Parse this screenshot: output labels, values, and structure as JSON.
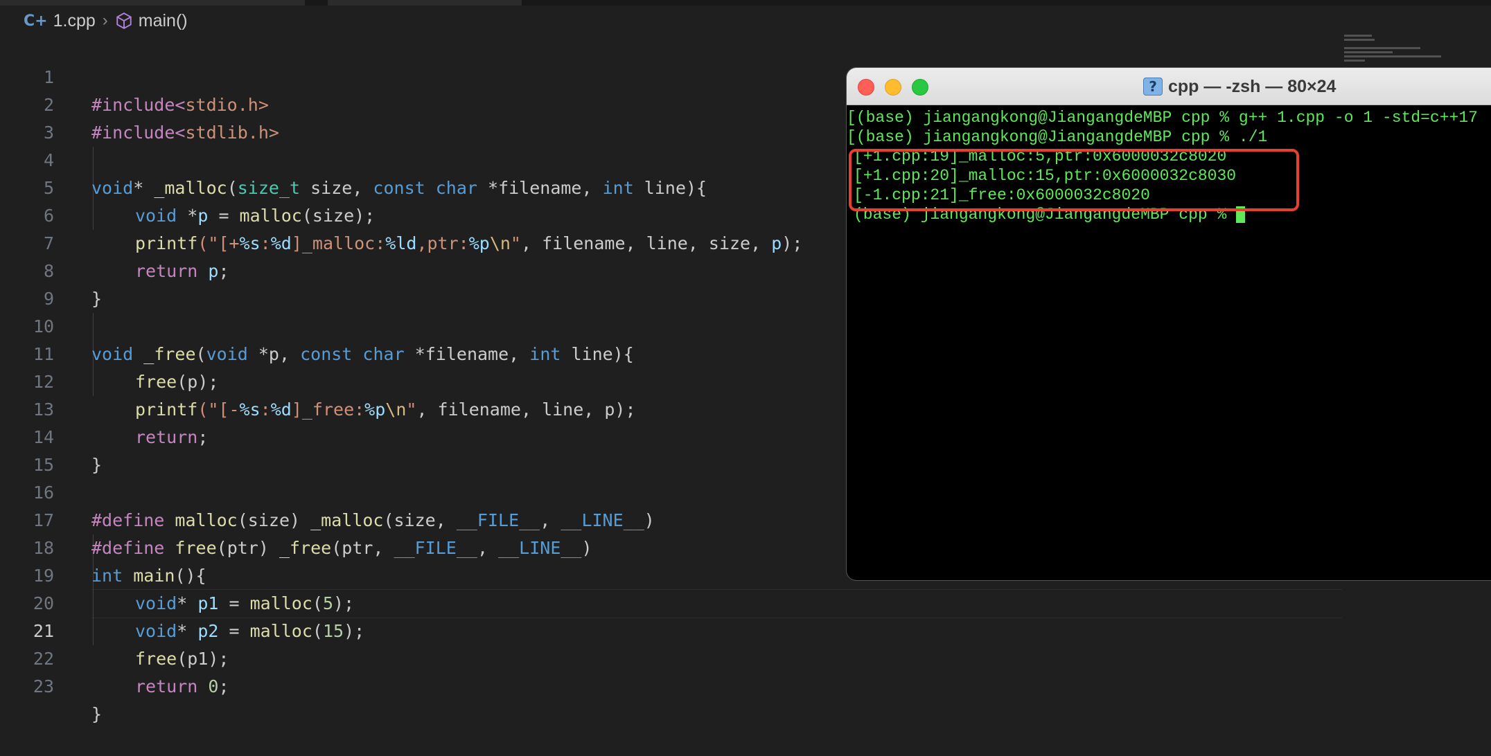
{
  "breadcrumb": {
    "file": "1.cpp",
    "symbol": "main()"
  },
  "editor": {
    "active_line": 21,
    "lines": [
      {
        "n": "1"
      },
      {
        "n": "2"
      },
      {
        "n": "3"
      },
      {
        "n": "4"
      },
      {
        "n": "5"
      },
      {
        "n": "6"
      },
      {
        "n": "7"
      },
      {
        "n": "8"
      },
      {
        "n": "9"
      },
      {
        "n": "10"
      },
      {
        "n": "11"
      },
      {
        "n": "12"
      },
      {
        "n": "13"
      },
      {
        "n": "14"
      },
      {
        "n": "15"
      },
      {
        "n": "16"
      },
      {
        "n": "17"
      },
      {
        "n": "18"
      },
      {
        "n": "19"
      },
      {
        "n": "20"
      },
      {
        "n": "21"
      },
      {
        "n": "22"
      },
      {
        "n": "23"
      }
    ],
    "tokens": {
      "l1_a": "#include<",
      "l1_b": "stdio.h",
      "l1_c": ">",
      "l2_a": "#include<",
      "l2_b": "stdlib.h",
      "l2_c": ">",
      "l4_a": "void",
      "l4_b": "* ",
      "l4_c": "_malloc",
      "l4_d": "(",
      "l4_e": "size_t",
      "l4_f": " size, ",
      "l4_g": "const",
      "l4_h": " ",
      "l4_i": "char",
      "l4_j": " *filename, ",
      "l4_k": "int",
      "l4_l": " line){",
      "l5_a": "void",
      "l5_b": " *",
      "l5_c": "p",
      "l5_d": " = ",
      "l5_e": "malloc",
      "l5_f": "(size);",
      "l6_a": "printf",
      "l6_b": "(\"",
      "l6_c": "[+",
      "l6_d": "%s",
      "l6_e": ":",
      "l6_f": "%d",
      "l6_g": "]_malloc:",
      "l6_h": "%ld",
      "l6_i": ",ptr:",
      "l6_j": "%p",
      "l6_k": "\\n",
      "l6_l": "\"",
      "l6_m": ", filename, line, size, ",
      "l6_n": "p",
      "l6_o": ");",
      "l7_a": "return",
      "l7_b": " ",
      "l7_c": "p",
      "l7_d": ";",
      "l8_a": "}",
      "l10_a": "void",
      "l10_b": " ",
      "l10_c": "_free",
      "l10_d": "(",
      "l10_e": "void",
      "l10_f": " *p, ",
      "l10_g": "const",
      "l10_h": " ",
      "l10_i": "char",
      "l10_j": " *filename, ",
      "l10_k": "int",
      "l10_l": " line){",
      "l11_a": "free",
      "l11_b": "(p);",
      "l12_a": "printf",
      "l12_b": "(\"",
      "l12_c": "[-",
      "l12_d": "%s",
      "l12_e": ":",
      "l12_f": "%d",
      "l12_g": "]_free:",
      "l12_h": "%p",
      "l12_i": "\\n",
      "l12_j": "\"",
      "l12_k": ", filename, line, p);",
      "l13_a": "return",
      "l13_b": ";",
      "l14_a": "}",
      "l16_a": "#define",
      "l16_b": " ",
      "l16_c": "malloc",
      "l16_d": "(size) ",
      "l16_e": "_malloc",
      "l16_f": "(size, ",
      "l16_g": "__FILE__",
      "l16_h": ", ",
      "l16_i": "__LINE__",
      "l16_j": ")",
      "l17_a": "#define",
      "l17_b": " ",
      "l17_c": "free",
      "l17_d": "(ptr) ",
      "l17_e": "_free",
      "l17_f": "(ptr, ",
      "l17_g": "__FILE__",
      "l17_h": ", ",
      "l17_i": "__LINE__",
      "l17_j": ")",
      "l18_a": "int",
      "l18_b": " ",
      "l18_c": "main",
      "l18_d": "(){",
      "l19_a": "void",
      "l19_b": "* ",
      "l19_c": "p1",
      "l19_d": " = ",
      "l19_e": "malloc",
      "l19_f": "(",
      "l19_g": "5",
      "l19_h": ");",
      "l20_a": "void",
      "l20_b": "* ",
      "l20_c": "p2",
      "l20_d": " = ",
      "l20_e": "malloc",
      "l20_f": "(",
      "l20_g": "15",
      "l20_h": ");",
      "l21_a": "free",
      "l21_b": "(p1);",
      "l22_a": "return",
      "l22_b": " ",
      "l22_c": "0",
      "l22_d": ";",
      "l23_a": "}"
    }
  },
  "terminal": {
    "title": "cpp — -zsh — 80×24",
    "lines": [
      "[(base) jiangangkong@JiangangdeMBP cpp % g++ 1.cpp -o 1 -std=c++17",
      "[(base) jiangangkong@JiangangdeMBP cpp % ./1",
      "[+1.cpp:19]_malloc:5,ptr:0x6000032c8020",
      "[+1.cpp:20]_malloc:15,ptr:0x6000032c8030",
      "[-1.cpp:21]_free:0x6000032c8020",
      "(base) jiangangkong@JiangangdeMBP cpp % "
    ]
  },
  "colors": {
    "editor_bg": "#1f1f1f",
    "terminal_bg": "#000000",
    "terminal_text": "#5fe85a",
    "highlight_box": "#e8402f"
  }
}
